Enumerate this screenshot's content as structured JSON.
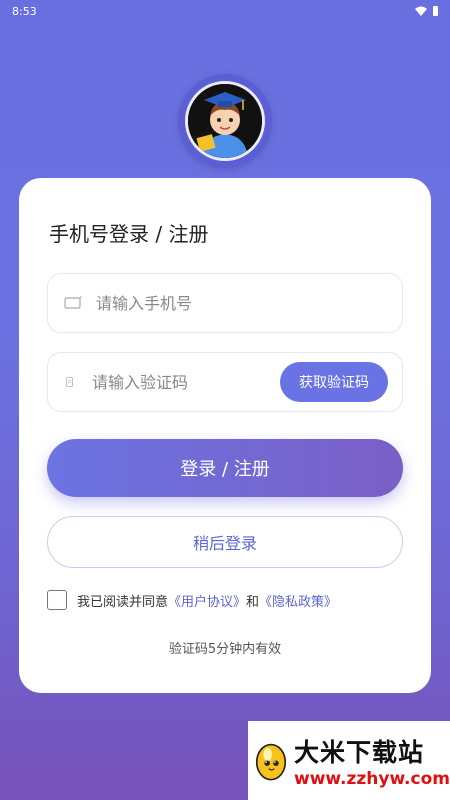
{
  "status_bar": {
    "time": "8:53"
  },
  "login": {
    "title": "手机号登录 / 注册",
    "phone_placeholder": "请输入手机号",
    "code_placeholder": "请输入验证码",
    "get_code_label": "获取验证码",
    "login_button": "登录 / 注册",
    "later_button": "稍后登录",
    "agree_prefix": "我已阅读并同意",
    "user_agreement": "《用户协议》",
    "and": "和",
    "privacy_policy": "《隐私政策》",
    "code_hint": "验证码5分钟内有效"
  },
  "watermark": {
    "title": "大米下载站",
    "url": "www.zzhyw.com"
  },
  "colors": {
    "accent": "#6a73e3",
    "link": "#5c66d6",
    "background_top": "#6a6fe0",
    "background_bottom": "#7752b8"
  }
}
